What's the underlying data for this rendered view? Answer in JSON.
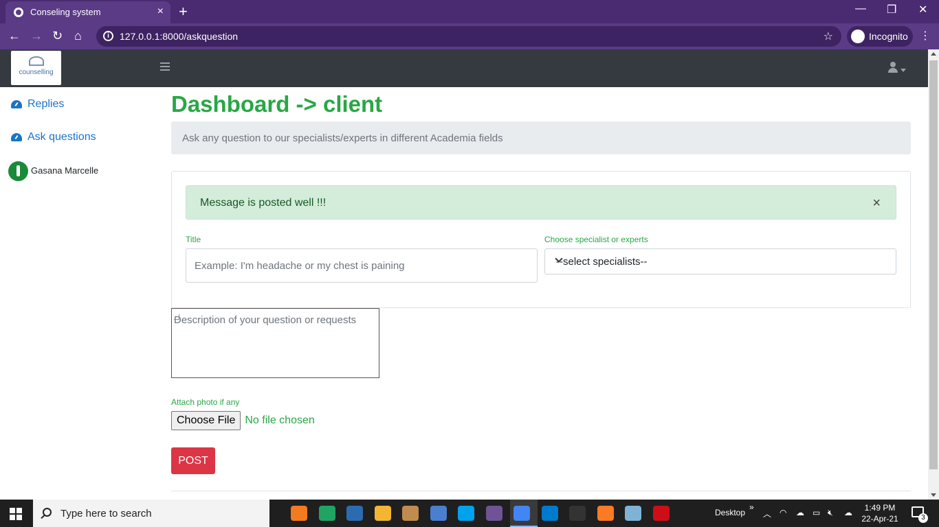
{
  "browser": {
    "tab_title": "Conseling system",
    "url_host": "127.0.0.1:8000/askquestion",
    "incognito_label": "Incognito"
  },
  "header": {
    "logo_text": "counselling"
  },
  "sidebar": {
    "items": [
      {
        "label": "Replies",
        "icon": "gauge-icon"
      },
      {
        "label": "Ask questions",
        "icon": "gauge-icon"
      }
    ],
    "user_name": "Gasana Marcelle"
  },
  "main": {
    "title": "Dashboard -> client",
    "lead": "Ask any question to our specialists/experts in different Academia fields",
    "alert": {
      "text": "Message is posted well !!!",
      "close": "×"
    },
    "title_label": "Title",
    "title_placeholder": "Example: I'm headache or my chest is paining",
    "specialist_label": "Choose specialist or experts",
    "specialist_selected": "--select specialists--",
    "description_placeholder": "Description of your question or requests",
    "attach_label": "Attach photo if any",
    "choose_file_label": "Choose File",
    "file_status": "No file chosen",
    "post_label": "POST"
  },
  "taskbar": {
    "search_placeholder": "Type here to search",
    "desktop_label": "Desktop",
    "time": "1:49 PM",
    "date": "22-Apr-21",
    "notification_count": "3",
    "app_colors": [
      "#f47a20",
      "#1fa463",
      "#2b6cb0",
      "#f2b632",
      "#c08b4f",
      "#4a7fd0",
      "#00a2ed",
      "#6e5494",
      "#4285f4",
      "#007acc",
      "#333333",
      "#fb7a24",
      "#7fb3d5",
      "#cc0f16"
    ]
  }
}
